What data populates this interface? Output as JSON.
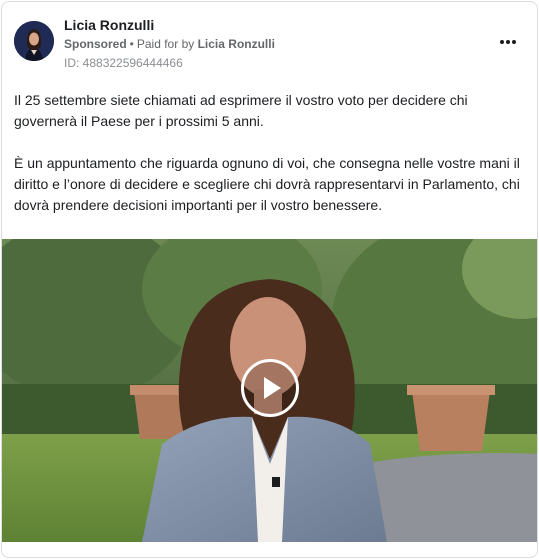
{
  "post": {
    "author": "Licia Ronzulli",
    "sponsored_label": "Sponsored",
    "separator": "•",
    "paid_for_prefix": "Paid for by",
    "payer": "Licia Ronzulli",
    "ad_id": "ID: 488322596444466",
    "more_icon": "more-horizontal-icon",
    "body": {
      "paragraph_1": "Il 25 settembre siete chiamati ad esprimere il vostro voto per decidere chi governerà il Paese per i prossimi 5 anni.",
      "paragraph_2": "È un appuntamento che riguarda ognuno di voi, che consegna nelle vostre mani il diritto e l’onore di decidere e scegliere chi dovrà rappresentarvi in Parlamento, chi dovrà prendere decisioni importanti per il vostro benessere.",
      "ellipsis": "..."
    },
    "video": {
      "play_icon": "play-icon"
    }
  }
}
